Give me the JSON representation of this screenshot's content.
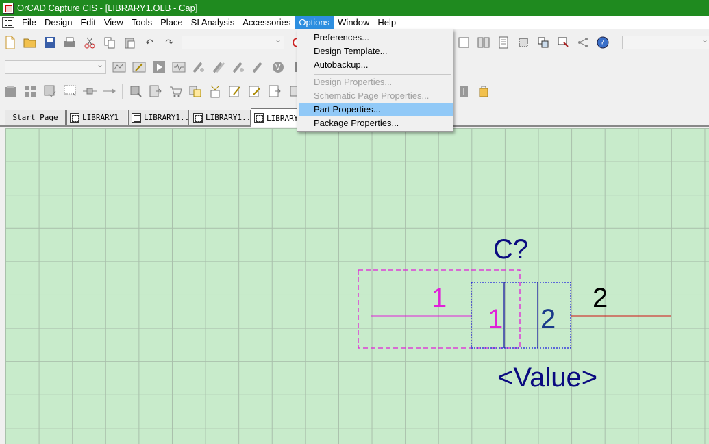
{
  "window": {
    "title": "OrCAD Capture CIS - [LIBRARY1.OLB - Cap]"
  },
  "menubar": {
    "items": [
      {
        "label": "File"
      },
      {
        "label": "Design"
      },
      {
        "label": "Edit"
      },
      {
        "label": "View"
      },
      {
        "label": "Tools"
      },
      {
        "label": "Place"
      },
      {
        "label": "SI Analysis"
      },
      {
        "label": "Accessories"
      },
      {
        "label": "Options"
      },
      {
        "label": "Window"
      },
      {
        "label": "Help"
      }
    ],
    "active": "Options"
  },
  "options_menu": {
    "items": [
      {
        "label": "Preferences...",
        "enabled": true
      },
      {
        "label": "Design Template...",
        "enabled": true
      },
      {
        "label": "Autobackup...",
        "enabled": true
      },
      {
        "label": "Design Properties...",
        "enabled": false
      },
      {
        "label": "Schematic Page Properties...",
        "enabled": false
      },
      {
        "label": "Part Properties...",
        "enabled": true,
        "highlighted": true
      },
      {
        "label": "Package Properties...",
        "enabled": true
      }
    ]
  },
  "tabs": [
    {
      "label": "Start Page"
    },
    {
      "label": "LIBRARY1"
    },
    {
      "label": "LIBRARY1..."
    },
    {
      "label": "LIBRARY1..."
    },
    {
      "label": "LIBRARY1"
    }
  ],
  "part": {
    "reference": "C?",
    "value": "<Value>",
    "pin1_number": "1",
    "pin1_name": "1",
    "pin2_number": "2",
    "pin2_name": "2"
  },
  "colors": {
    "titlebar": "#1f8a1f",
    "canvas": "#c8ebcb",
    "grid": "#a9bfab",
    "menu_active": "#2e8fe0",
    "menu_highlight": "#91c9f7",
    "pin1": "#e020d8",
    "pin2_wire": "#d01010",
    "part_text": "#0a0a80"
  }
}
